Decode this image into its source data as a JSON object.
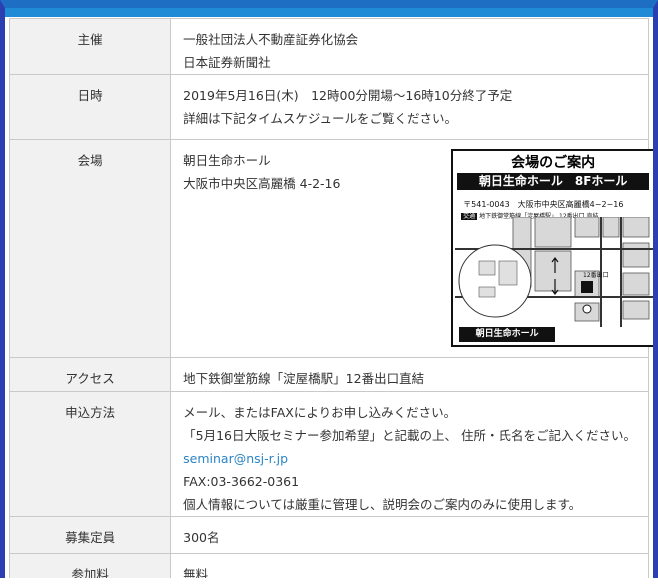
{
  "rows": {
    "host": {
      "label": "主催",
      "lines": [
        "一般社団法人不動産証券化協会",
        "日本証券新聞社"
      ]
    },
    "date": {
      "label": "日時",
      "lines": [
        "2019年5月16日(木)　12時00分開場～16時10分終了予定",
        "詳細は下記タイムスケジュールをご覧ください。"
      ]
    },
    "venue": {
      "label": "会場",
      "lines": [
        "朝日生命ホール",
        "大阪市中央区高麗橋 4-2-16"
      ]
    },
    "access": {
      "label": "アクセス",
      "lines": [
        "地下鉄御堂筋線「淀屋橋駅」12番出口直結"
      ]
    },
    "apply": {
      "label": "申込方法",
      "lines": [
        "メール、またはFAXによりお申し込みください。",
        "「5月16日大阪セミナー参加希望」と記載の上、 住所・氏名をご記入ください。",
        "seminar@nsj-r.jp",
        "FAX:03-3662-0361",
        "個人情報については厳重に管理し、説明会のご案内のみに使用します。"
      ]
    },
    "capacity": {
      "label": "募集定員",
      "lines": [
        "300名"
      ]
    },
    "fee": {
      "label": "参加料",
      "lines": [
        "無料"
      ]
    }
  },
  "map": {
    "title": "会場のご案内",
    "hall": "朝日生命ホール　8Fホール",
    "address": "〒541-0043　大阪市中央区高麗橋4−2−16",
    "transit_tag": "交通",
    "transit": "地下鉄御堂筋線「淀屋橋駅」 12番出口 直結",
    "footer": "朝日生命ホール",
    "exit_label": "12番出口"
  },
  "colors": {
    "frame": "#2c3fb0",
    "topbar": "#1f8bd6",
    "label_bg": "#f1f1f1",
    "link": "#2a84c6"
  }
}
